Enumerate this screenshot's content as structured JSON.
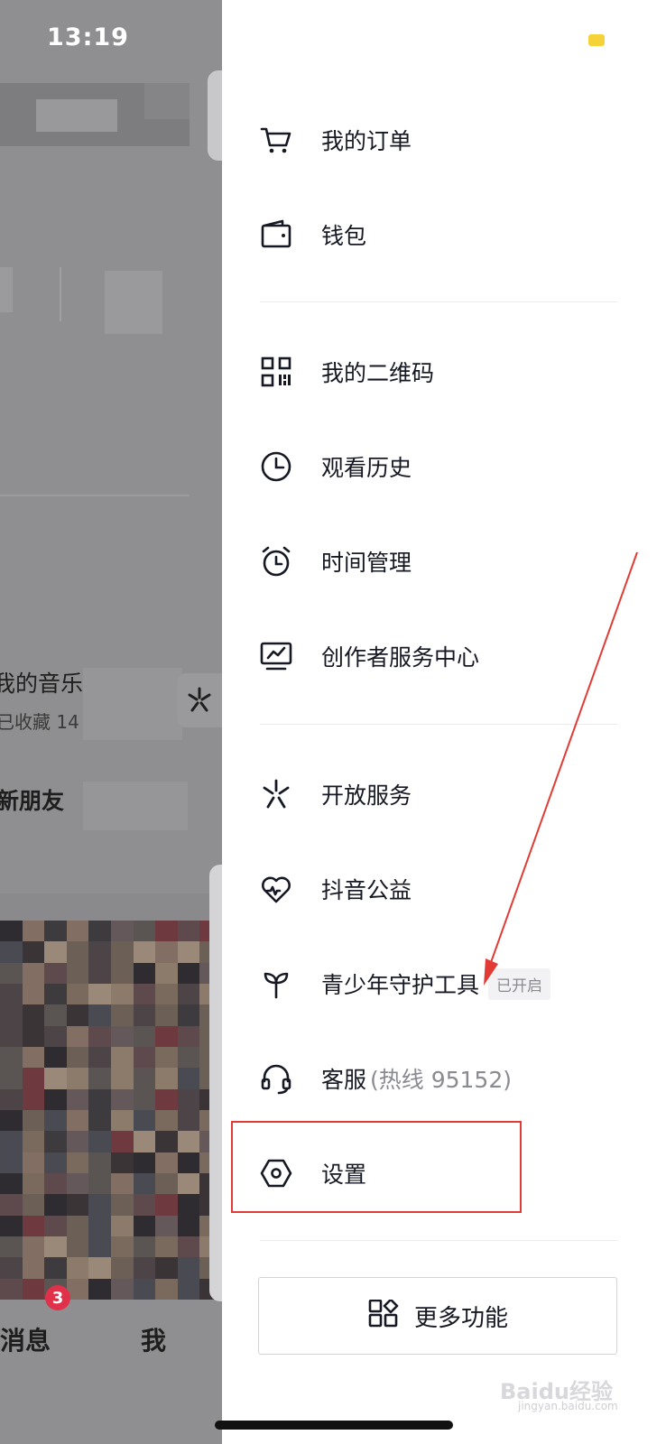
{
  "status_bar": {
    "time": "13:19"
  },
  "background": {
    "music_title": "我的音乐",
    "music_sub": "已收藏 14",
    "friends_label": "新朋友",
    "tab_messages": "消息",
    "tab_messages_badge": "3",
    "tab_me": "我"
  },
  "drawer": {
    "items": [
      {
        "label": "我的订单",
        "icon": "cart-icon"
      },
      {
        "label": "钱包",
        "icon": "wallet-icon"
      },
      {
        "label": "我的二维码",
        "icon": "qrcode-icon"
      },
      {
        "label": "观看历史",
        "icon": "clock-icon"
      },
      {
        "label": "时间管理",
        "icon": "alarm-icon"
      },
      {
        "label": "创作者服务中心",
        "icon": "monitor-chart-icon"
      },
      {
        "label": "开放服务",
        "icon": "sparkle-icon"
      },
      {
        "label": "抖音公益",
        "icon": "heart-icon"
      },
      {
        "label": "青少年守护工具",
        "icon": "sprout-icon",
        "tag": "已开启"
      },
      {
        "label": "客服",
        "hint": "(热线 95152)",
        "icon": "headset-icon"
      },
      {
        "label": "设置",
        "icon": "settings-hexagon-icon"
      }
    ],
    "more_button": {
      "label": "更多功能",
      "icon": "grid-apps-icon"
    }
  },
  "watermark": {
    "text": "Baidu经验",
    "sub": "jingyan.baidu.com"
  },
  "colors": {
    "highlight": "#e23b36",
    "battery": "#f5d23a",
    "badge": "#e0304a"
  }
}
